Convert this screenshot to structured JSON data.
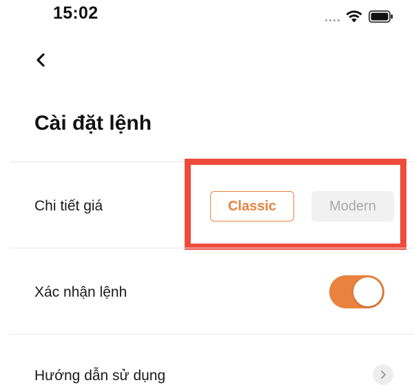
{
  "status_bar": {
    "time": "15:02",
    "icons": [
      "signal-dots-icon",
      "wifi-icon",
      "battery-icon"
    ]
  },
  "header": {
    "back_icon": "chevron-left-icon",
    "title": "Cài đặt lệnh"
  },
  "settings": {
    "price_detail": {
      "label": "Chi tiết giá",
      "options": [
        "Classic",
        "Modern"
      ],
      "selected": "Classic"
    },
    "order_confirm": {
      "label": "Xác nhận lệnh",
      "enabled": true
    },
    "guide": {
      "label": "Hướng dẫn sử dụng",
      "icon": "chevron-right-icon"
    }
  },
  "colors": {
    "accent": "#e8823e",
    "highlight": "#ef4b3c",
    "muted_text": "#a9a9a9",
    "muted_bg": "#f1f1f1"
  }
}
